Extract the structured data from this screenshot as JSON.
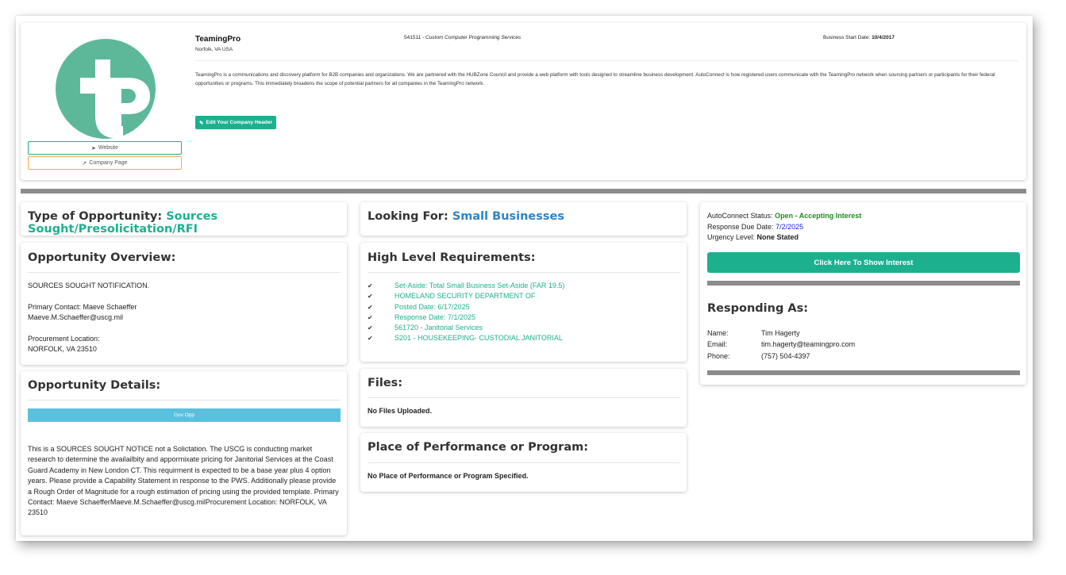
{
  "company": {
    "name": "TeamingPro",
    "location": "Norfolk, VA USA",
    "naics_code": "541511 - ",
    "naics_title": "Custom Computer Programming Services",
    "start_label": "Business Start Date: ",
    "start_date": "10/4/2017",
    "description": "TeamingPro is a communications and discovery platform for B2B companies and organizations. We are partnered with the HUBZone Council and provide a web platform with tools designed to streamline business development. AutoConnect is how registered users communicate with the TeamingPro network when sourcing partners or participants for their federal opportunities or programs. This immediately broadens the scope of potential partners for all companies in the TeamingPro network.",
    "edit_button": "Edit Your Company Header",
    "website_button": "Website",
    "company_page_button": "Company Page",
    "logo_icon": "tp-logo"
  },
  "type_card": {
    "label": "Type of Opportunity: ",
    "value": "Sources Sought/Presolicitation/RFI"
  },
  "looking_card": {
    "label": "Looking For: ",
    "value": "Small Businesses"
  },
  "overview": {
    "title": "Opportunity Overview:",
    "line1": "SOURCES SOUGHT NOTIFICATION.",
    "contact_line": "Primary Contact: Maeve Schaeffer",
    "email_line": "Maeve.M.Schaeffer@uscg.mil",
    "location_label": "Procurement Location:",
    "location_value": "NORFOLK, VA 23510"
  },
  "details": {
    "title": "Opportunity Details:",
    "tag": "Gov Opp",
    "text": "This is a SOURCES SOUGHT NOTICE not a Solictation. The USCG is conducting market research to determine the availailbity and appormixate pricing for Janitorial Services at the Coast Guard Academy in New London CT. This requirment is expected to be a base year plus 4 option years. Please provide a Capability Statement in response to the PWS. Additionally please provide a Rough Order of Magnitude for a rough estimation of pricing using the provided template. Primary Contact: Maeve SchaefferMaeve.M.Schaeffer@uscg.milProcurement Location: NORFOLK, VA 23510"
  },
  "requirements": {
    "title": "High Level Requirements:",
    "items": [
      "Set-Aside: Total Small Business Set-Aside (FAR 19.5)",
      "HOMELAND SECURITY DEPARTMENT OF",
      "Posted Date: 6/17/2025",
      "Response Date: 7/1/2025",
      "561720 - Janitorial Services",
      "S201 - HOUSEKEEPING- CUSTODIAL JANITORIAL"
    ]
  },
  "files": {
    "title": "Files:",
    "empty": "No Files Uploaded."
  },
  "performance": {
    "title": "Place of Performance or Program:",
    "empty": "No Place of Performance or Program Specified."
  },
  "autoconnect": {
    "status_label": "AutoConnect Status: ",
    "status_value": "Open - Accepting Interest",
    "due_label": "Response Due Date: ",
    "due_value": "7/2/2025",
    "urgency_label": "Urgency Level: ",
    "urgency_value": "None Stated",
    "button": "Click Here To Show Interest",
    "responding_title": "Responding As:",
    "name_label": "Name:",
    "name_value": "Tim Hagerty",
    "email_label": "Email:",
    "email_value": "tim.hagerty@teamingpro.com",
    "phone_label": "Phone:",
    "phone_value": "(757) 504-4397"
  },
  "colors": {
    "accent": "#1cb08e",
    "link_blue": "#2f82c4",
    "status_green": "#1a8f1a",
    "date_blue": "#1a1ad0",
    "divider": "#8c8c8c",
    "tag": "#5bc0de"
  }
}
